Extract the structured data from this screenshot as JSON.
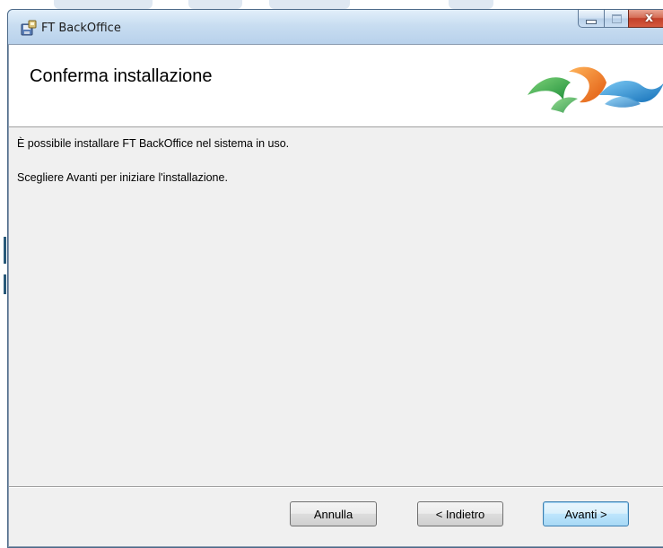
{
  "window": {
    "title": "FT BackOffice",
    "app_icon": "installer-disk-icon",
    "caption": {
      "minimize_icon": "minimize-icon",
      "maximize_icon": "maximize-icon",
      "close_label": "x"
    }
  },
  "banner": {
    "title": "Conferma installazione",
    "logo_icon": "wave-logo-icon"
  },
  "content": {
    "line1": "È possibile installare FT BackOffice nel sistema in uso.",
    "line2": "Scegliere Avanti per iniziare l'installazione."
  },
  "buttons": {
    "cancel": "Annulla",
    "back": "< Indietro",
    "next": "Avanti >"
  },
  "colors": {
    "accent_orange": "#f07a18",
    "accent_green": "#3aa93c",
    "accent_blue": "#1e8fd6",
    "close_red": "#c3402a"
  }
}
